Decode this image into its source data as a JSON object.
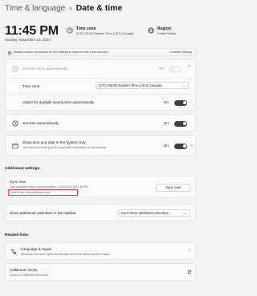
{
  "breadcrumb": {
    "parent": "Time & language",
    "separator": "›",
    "current": "Date & time"
  },
  "clock": {
    "time": "11:45 PM",
    "date": "Sunday, November 10, 2024"
  },
  "summary": {
    "timezone": {
      "title": "Time zone",
      "value": "(UTC-05:00) Eastern Time (US & Canada)"
    },
    "region": {
      "title": "Region",
      "value": "United States"
    }
  },
  "location_banner": {
    "text": "Enable location permission for the Settings to improve time zone accuracy.",
    "link": "Location Settings"
  },
  "rows": {
    "set_tz_auto": {
      "label": "Set time zone automatically",
      "state": "Off"
    },
    "timezone": {
      "label": "Time zone",
      "value": "(UTC-05:00) Eastern Time (US & Canada)"
    },
    "dst": {
      "label": "Adjust for daylight saving time automatically",
      "state": "On"
    },
    "set_time_auto": {
      "label": "Set time automatically",
      "state": "On"
    },
    "tray": {
      "label": "Show time and date in the System tray",
      "sub": "Turn this off to hide your time and date information on the taskbar",
      "state": "On"
    }
  },
  "additional": {
    "heading": "Additional settings",
    "sync": {
      "title": "Sync now",
      "last": "Last successful time synchronization: 11/10/2024 8:57:48 PM",
      "server": "Time server: time.windows.com",
      "button": "Sync now"
    },
    "calendar": {
      "label": "Show additional calendars in the taskbar",
      "value": "Don't show additional calendars"
    }
  },
  "related": {
    "heading": "Related links",
    "items": [
      {
        "title": "Language & region",
        "sub": "Windows and some apps format dates and time based on your region"
      },
      {
        "title": "Additional clocks",
        "sub": "Clocks for different time zones"
      }
    ]
  },
  "icons": {
    "clock": "clock-icon",
    "globe": "globe-icon",
    "tray": "calendar-tray-icon",
    "language": "language-icon",
    "external": "external-link-icon"
  }
}
